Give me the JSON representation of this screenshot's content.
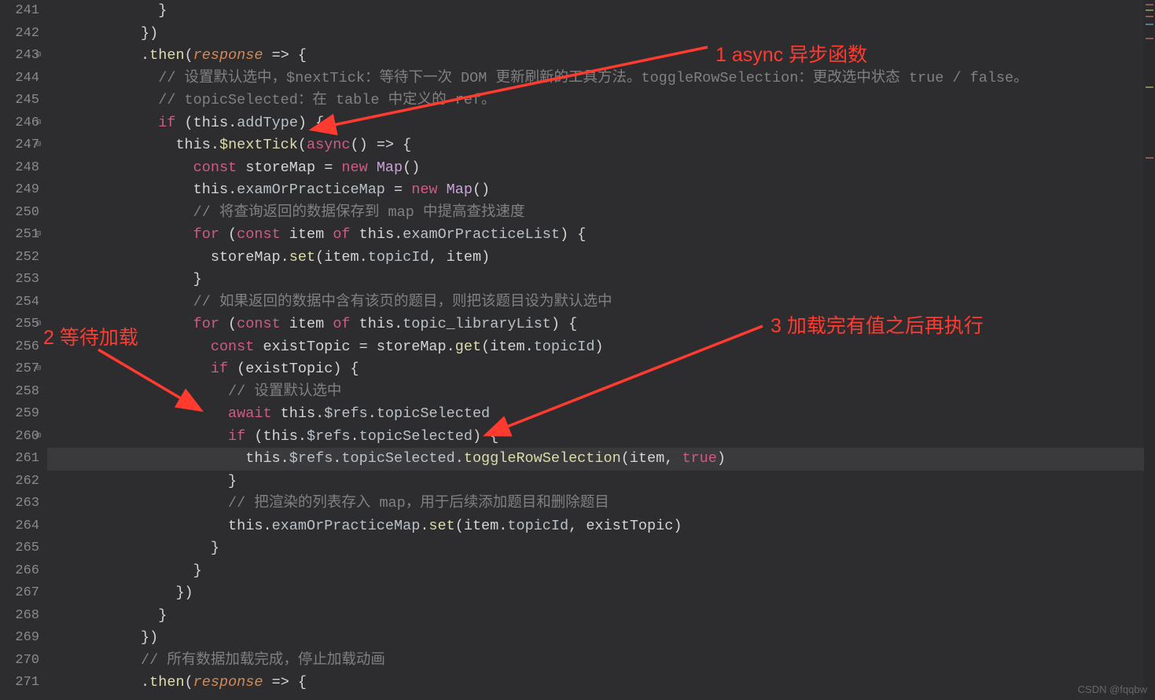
{
  "annotations": {
    "a1": "1 async 异步函数",
    "a2": "2 等待加载",
    "a3": "3 加载完有值之后再执行"
  },
  "watermark": "CSDN @fqqbw",
  "lines": {
    "241": {
      "num": "241",
      "indent": "            ",
      "t1": "}"
    },
    "242": {
      "num": "242",
      "indent": "          ",
      "t1": "})"
    },
    "243": {
      "num": "243",
      "indent": "          ",
      "dot": ".",
      "then": "then",
      "open": "(",
      "response": "response",
      "arrow": " => {"
    },
    "244": {
      "num": "244",
      "indent": "            ",
      "c": "// 设置默认选中，$nextTick：等待下一次 DOM 更新刷新的工具方法。toggleRowSelection：更改选中状态 true / false。"
    },
    "245": {
      "num": "245",
      "indent": "            ",
      "c": "// topicSelected：在 table 中定义的 ref。"
    },
    "246": {
      "num": "246",
      "indent": "            ",
      "if": "if",
      "open": " (",
      "this": "this",
      "dot": ".",
      "prop": "addType",
      "close": ") {"
    },
    "247": {
      "num": "247",
      "indent": "              ",
      "this": "this",
      "dot": ".",
      "method": "$nextTick",
      "open": "(",
      "async": "async",
      "paren": "() => {"
    },
    "248": {
      "num": "248",
      "indent": "                ",
      "const": "const",
      "sp": " ",
      "name": "storeMap",
      "eq": " = ",
      "new": "new",
      "sp2": " ",
      "type": "Map",
      "call": "()"
    },
    "249": {
      "num": "249",
      "indent": "                ",
      "this": "this",
      "dot": ".",
      "prop": "examOrPracticeMap",
      "eq": " = ",
      "new": "new",
      "sp2": " ",
      "type": "Map",
      "call": "()"
    },
    "250": {
      "num": "250",
      "indent": "                ",
      "c": "// 将查询返回的数据保存到 map 中提高查找速度"
    },
    "251": {
      "num": "251",
      "indent": "                ",
      "for": "for",
      "open": " (",
      "const": "const",
      "sp": " ",
      "item": "item",
      "of": " of ",
      "this": "this",
      "dot": ".",
      "prop": "examOrPracticeList",
      "close": ") {"
    },
    "252": {
      "num": "252",
      "indent": "                  ",
      "obj": "storeMap",
      "dot": ".",
      "method": "set",
      "open": "(",
      "arg1": "item",
      "d2": ".",
      "p2": "topicId",
      "comma": ", ",
      "arg2": "item",
      "close": ")"
    },
    "253": {
      "num": "253",
      "indent": "                ",
      "t1": "}"
    },
    "254": {
      "num": "254",
      "indent": "                ",
      "c": "// 如果返回的数据中含有该页的题目，则把该题目设为默认选中"
    },
    "255": {
      "num": "255",
      "indent": "                ",
      "for": "for",
      "open": " (",
      "const": "const",
      "sp": " ",
      "item": "item",
      "of": " of ",
      "this": "this",
      "dot": ".",
      "prop": "topic_libraryList",
      "close": ") {"
    },
    "256": {
      "num": "256",
      "indent": "                  ",
      "const": "const",
      "sp": " ",
      "name": "existTopic",
      "eq": " = ",
      "obj": "storeMap",
      "dot": ".",
      "method": "get",
      "open": "(",
      "arg1": "item",
      "d2": ".",
      "p2": "topicId",
      "close": ")"
    },
    "257": {
      "num": "257",
      "indent": "                  ",
      "if": "if",
      "open": " (",
      "name": "existTopic",
      "close": ") {"
    },
    "258": {
      "num": "258",
      "indent": "                    ",
      "c": "// 设置默认选中"
    },
    "259": {
      "num": "259",
      "indent": "                    ",
      "await": "await",
      "sp": " ",
      "this": "this",
      "dot": ".",
      "refs": "$refs",
      "d2": ".",
      "prop": "topicSelected"
    },
    "260": {
      "num": "260",
      "indent": "                    ",
      "if": "if",
      "open": " (",
      "this": "this",
      "dot": ".",
      "refs": "$refs",
      "d2": ".",
      "prop": "topicSelected",
      "close": ") {"
    },
    "261": {
      "num": "261",
      "indent": "                      ",
      "this": "this",
      "dot": ".",
      "refs": "$refs",
      "d2": ".",
      "prop": "topicSelected",
      "d3": ".",
      "method": "toggleRowSelection",
      "open": "(",
      "arg1": "item",
      "comma": ", ",
      "bool": "true",
      "close": ")"
    },
    "262": {
      "num": "262",
      "indent": "                    ",
      "t1": "}"
    },
    "263": {
      "num": "263",
      "indent": "                    ",
      "c": "// 把渲染的列表存入 map，用于后续添加题目和删除题目"
    },
    "264": {
      "num": "264",
      "indent": "                    ",
      "this": "this",
      "dot": ".",
      "prop": "examOrPracticeMap",
      "d2": ".",
      "method": "set",
      "open": "(",
      "arg1": "item",
      "d3": ".",
      "p2": "topicId",
      "comma": ", ",
      "arg2": "existTopic",
      "close": ")"
    },
    "265": {
      "num": "265",
      "indent": "                  ",
      "t1": "}"
    },
    "266": {
      "num": "266",
      "indent": "                ",
      "t1": "}"
    },
    "267": {
      "num": "267",
      "indent": "              ",
      "t1": "})"
    },
    "268": {
      "num": "268",
      "indent": "            ",
      "t1": "}"
    },
    "269": {
      "num": "269",
      "indent": "          ",
      "t1": "})"
    },
    "270": {
      "num": "270",
      "indent": "          ",
      "c": "// 所有数据加载完成，停止加载动画"
    },
    "271": {
      "num": "271",
      "indent": "          ",
      "dot": ".",
      "then": "then",
      "open": "(",
      "response": "response",
      "arrow": " => {"
    }
  }
}
